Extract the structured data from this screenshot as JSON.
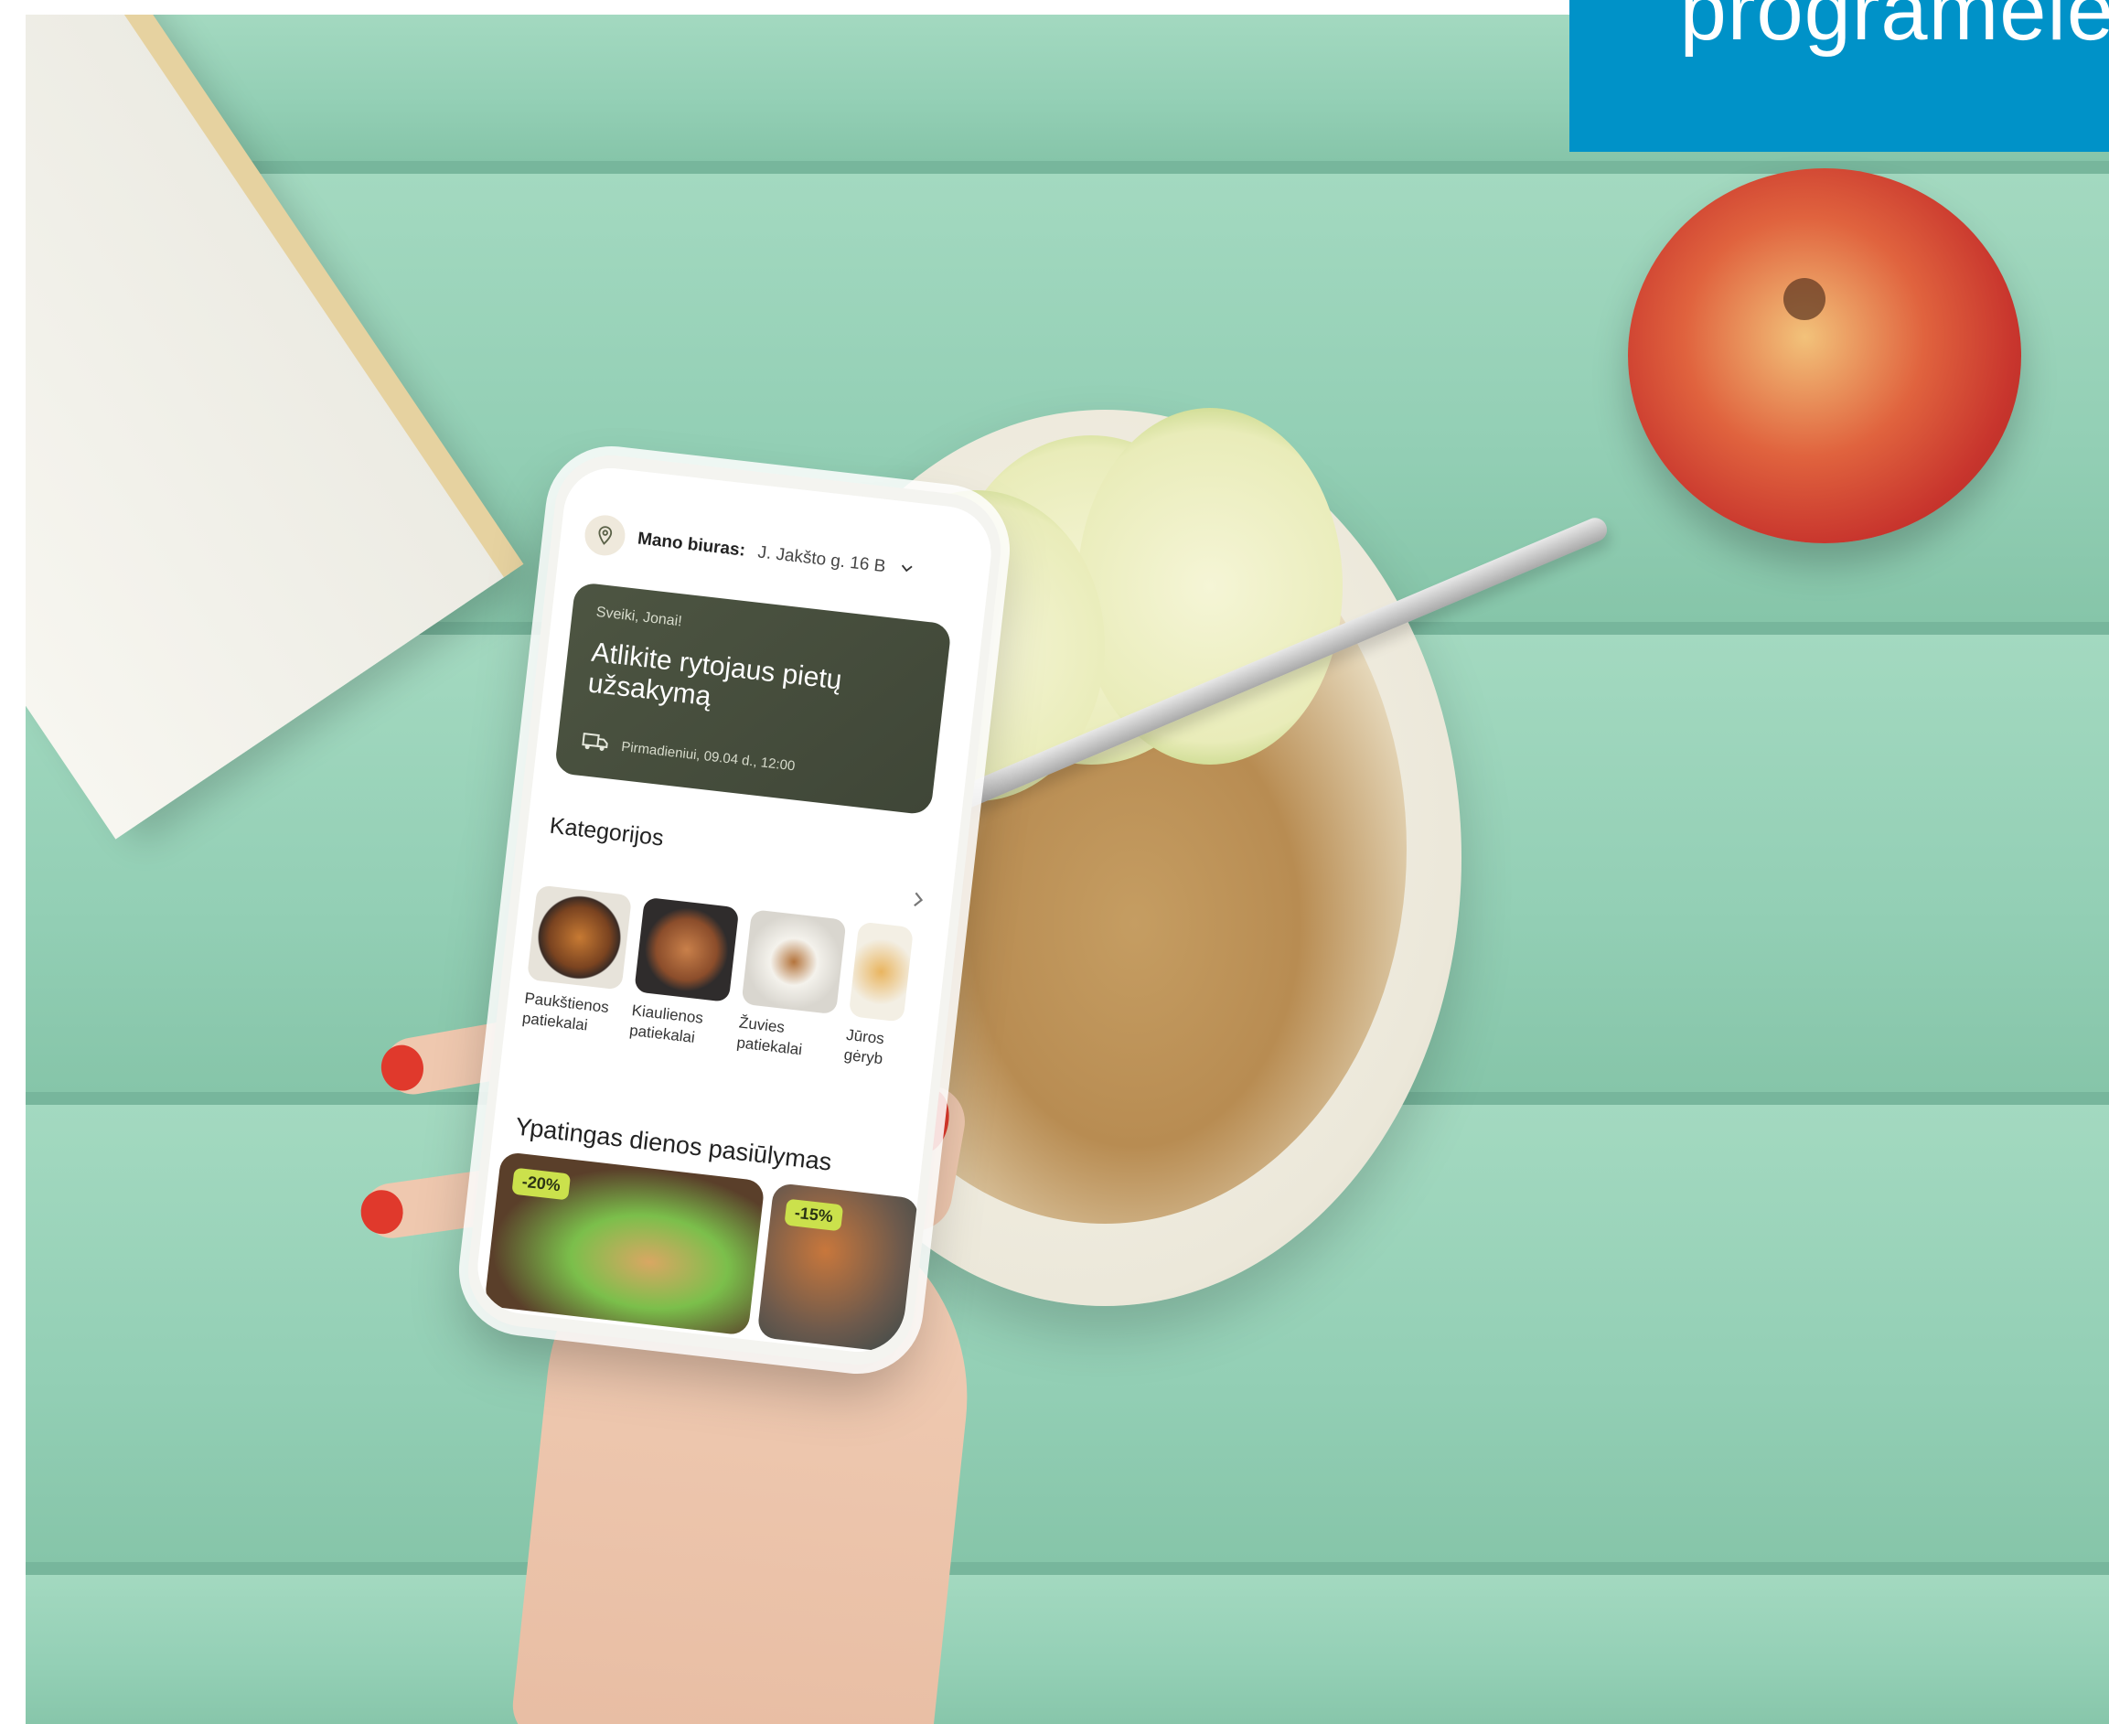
{
  "banner": {
    "text": "programėlė",
    "color": "#0092c8"
  },
  "app": {
    "location": {
      "icon": "map-pin-icon",
      "label": "Mano biuras:",
      "address": "J. Jakšto g. 16 B",
      "dropdown_icon": "chevron-down-icon"
    },
    "promo": {
      "greeting": "Sveiki, Jonai!",
      "title": "Atlikite rytojaus pietų užsakymą",
      "delivery_icon": "delivery-truck-icon",
      "date": "Pirmadieniui, 09.04 d., 12:00"
    },
    "categories": {
      "title": "Kategorijos",
      "more_icon": "chevron-right-icon",
      "items": [
        {
          "label": "Paukštienos patiekalai"
        },
        {
          "label": "Kiaulienos patiekalai"
        },
        {
          "label": "Žuvies patiekalai"
        },
        {
          "label": "Jūros gėryb"
        }
      ]
    },
    "deals": {
      "title": "Ypatingas dienos pasiūlymas",
      "items": [
        {
          "badge": "-20%"
        },
        {
          "badge": "-15%"
        }
      ]
    }
  }
}
